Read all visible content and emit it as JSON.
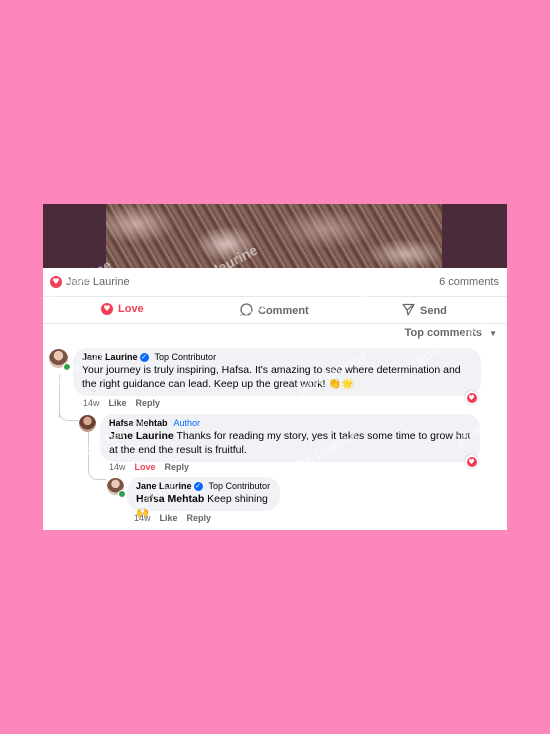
{
  "post": {
    "reaction_icon": "heart-icon",
    "reacted_by": "Jane Laurine",
    "comments_count": "6 comments"
  },
  "actions": {
    "love": "Love",
    "comment": "Comment",
    "send": "Send"
  },
  "sort_label": "Top comments",
  "comments": [
    {
      "author": "Jane Laurine",
      "badge": "Top Contributor",
      "text": "Your journey is truly inspiring, Hafsa. It's amazing to see where determination and the right guidance can lead. Keep up the great work! 👏🌟",
      "time": "14w",
      "like": "Like",
      "reply": "Reply"
    },
    {
      "author": "Hafsa Mehtab",
      "badge": "Author",
      "mention": "Jane Laurine",
      "text": " Thanks for reading my story, yes it takes some time to grow but at the end the result is fruitful.",
      "time": "14w",
      "like": "Love",
      "reply": "Reply"
    },
    {
      "author": "Jane Laurine",
      "badge": "Top Contributor",
      "mention": "Hafsa Mehtab",
      "text": " Keep shining🙌",
      "time": "14w",
      "like": "Like",
      "reply": "Reply"
    }
  ],
  "watermark": "jane laurine",
  "colors": {
    "background": "#fd86bc",
    "love": "#f33e58",
    "verified": "#0866ff",
    "bubble": "#f0f2f5"
  }
}
